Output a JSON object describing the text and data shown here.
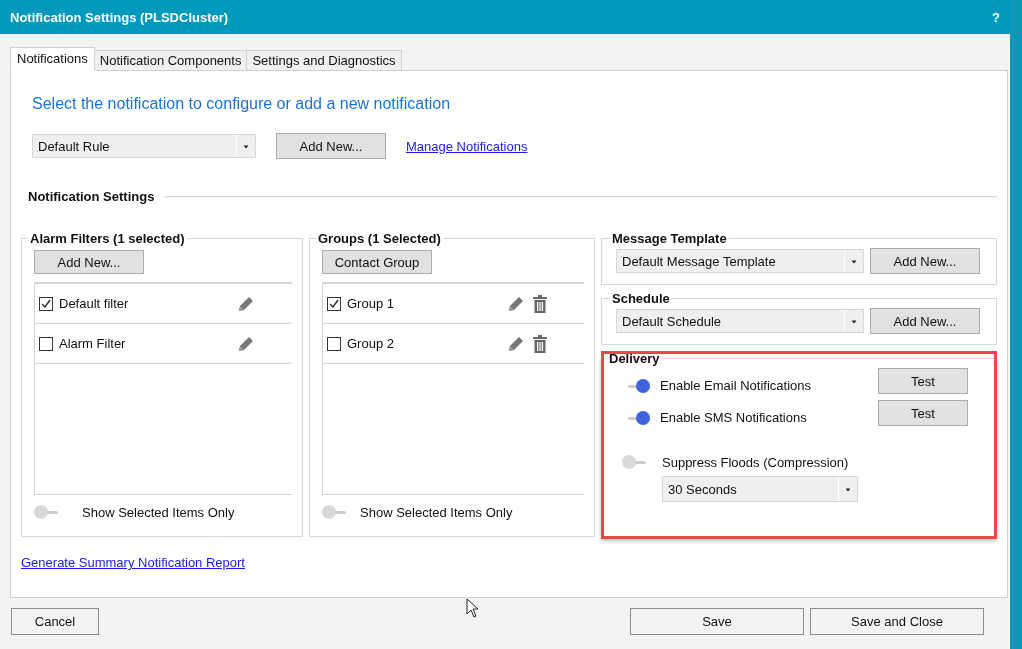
{
  "window": {
    "title": "Notification Settings (PLSDCluster)",
    "help": "?"
  },
  "tabs": [
    {
      "label": "Notifications",
      "selected": true
    },
    {
      "label": "Notification Components",
      "selected": false
    },
    {
      "label": "Settings and Diagnostics",
      "selected": false
    }
  ],
  "heading": "Select the notification to configure or add a new notification",
  "rule_select": {
    "value": "Default Rule"
  },
  "add_rule_button": "Add New...",
  "manage_link": "Manage Notifications",
  "section_title": "Notification Settings",
  "alarm_filters": {
    "title": "Alarm Filters (1 selected)",
    "button": "Add New...",
    "items": [
      {
        "label": "Default filter",
        "checked": true,
        "deletable": false
      },
      {
        "label": "Alarm Filter",
        "checked": false,
        "deletable": false
      }
    ],
    "toggle": {
      "label": "Show Selected Items Only",
      "on": false
    }
  },
  "groups": {
    "title": "Groups (1 Selected)",
    "button": "Contact Group",
    "items": [
      {
        "label": "Group 1",
        "checked": true,
        "deletable": true
      },
      {
        "label": "Group 2",
        "checked": false,
        "deletable": true
      }
    ],
    "toggle": {
      "label": "Show Selected Items Only",
      "on": false
    }
  },
  "message_template": {
    "title": "Message Template",
    "value": "Default Message Template",
    "button": "Add New..."
  },
  "schedule": {
    "title": "Schedule",
    "value": "Default Schedule",
    "button": "Add New..."
  },
  "delivery": {
    "title": "Delivery",
    "highlighted": true,
    "options": [
      {
        "kind": "test",
        "label": "Enable Email Notifications",
        "on": true,
        "button": "Test"
      },
      {
        "kind": "test",
        "label": "Enable SMS Notifications",
        "on": true,
        "button": "Test"
      },
      {
        "kind": "select",
        "label": "Suppress Floods (Compression)",
        "on": false,
        "value": "30 Seconds"
      }
    ]
  },
  "report_link": "Generate Summary Notification Report",
  "footer": {
    "cancel": "Cancel",
    "save": "Save",
    "save_close": "Save and Close"
  }
}
